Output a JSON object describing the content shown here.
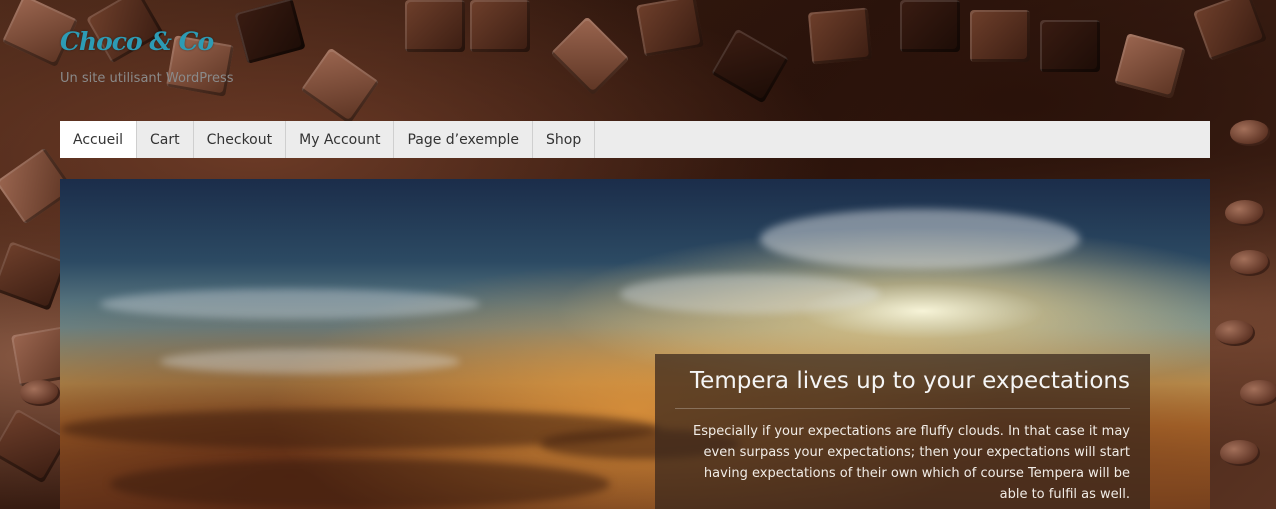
{
  "site": {
    "title": "Choco & Co",
    "description": "Un site utilisant WordPress"
  },
  "nav": {
    "items": [
      {
        "label": "Accueil",
        "active": true
      },
      {
        "label": "Cart",
        "active": false
      },
      {
        "label": "Checkout",
        "active": false
      },
      {
        "label": "My Account",
        "active": false
      },
      {
        "label": "Page d’exemple",
        "active": false
      },
      {
        "label": "Shop",
        "active": false
      }
    ]
  },
  "slider": {
    "caption_title": "Tempera lives up to your expectations",
    "caption_text": "Especially if your expectations are fluffy clouds. In that case it may even surpass your expectations; then your expectations will start having expectations of their own which of course Tempera will be able to fulfil as well."
  },
  "colors": {
    "title": "#2d9bb4",
    "nav_bg": "#ececec",
    "nav_active": "#ffffff"
  }
}
